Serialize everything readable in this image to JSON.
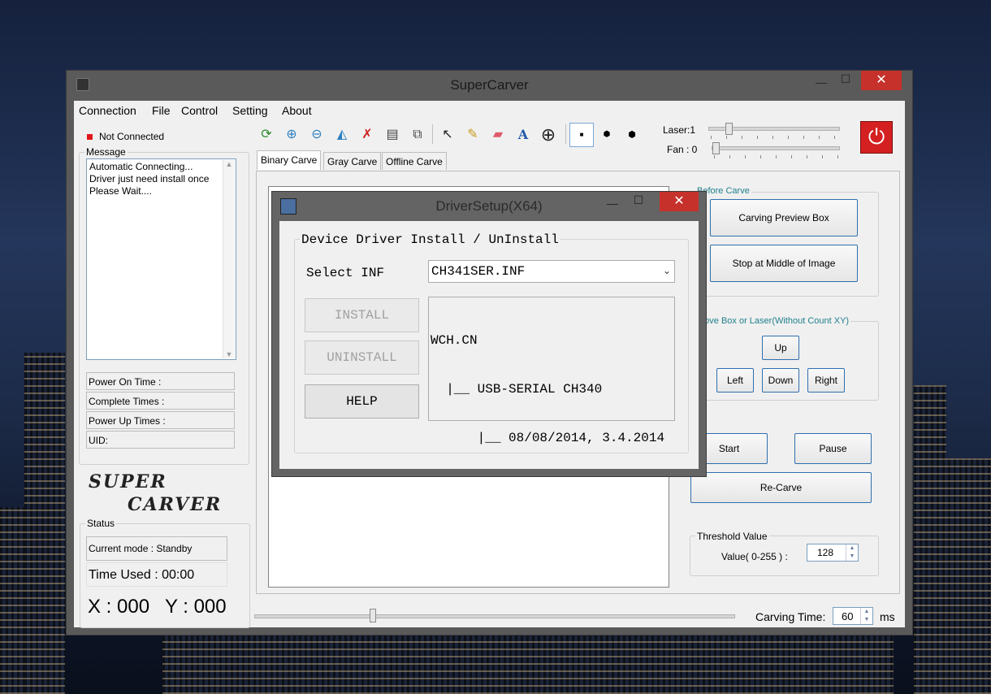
{
  "window": {
    "title": "SuperCarver",
    "minimize": "—",
    "maximize": "☐",
    "close": "✕"
  },
  "menu": [
    "Connection",
    "File",
    "Control",
    "Setting",
    "About"
  ],
  "connection_status": "Not Connected",
  "message": {
    "title": "Message",
    "lines": [
      "Automatic Connecting...",
      "Driver just need install once",
      "Please Wait...."
    ]
  },
  "info": {
    "power_on": "Power On Time :",
    "complete_times": "Complete Times :",
    "power_up_times": "Power Up Times :",
    "uid": "UID:"
  },
  "logo": {
    "line1": "SUPER",
    "line2": "CARVER"
  },
  "status": {
    "title": "Status",
    "mode": "Current mode : Standby",
    "time_used": "Time Used :  00:00",
    "x": "X : 000",
    "y": "Y : 000"
  },
  "laser": {
    "label": "Laser:1",
    "level": 1
  },
  "fan": {
    "label": "Fan : 0",
    "level": 0
  },
  "tabs": [
    "Binary Carve",
    "Gray Carve",
    "Offline Carve"
  ],
  "before_carve": {
    "title": "Before Carve",
    "preview": "Carving Preview Box",
    "stop_middle": "Stop at Middle of Image"
  },
  "move_box": {
    "title": "Move Box or Laser(Without Count XY)",
    "up": "Up",
    "left": "Left",
    "down": "Down",
    "right": "Right"
  },
  "controls": {
    "start": "Start",
    "pause": "Pause",
    "recarve": "Re-Carve"
  },
  "threshold": {
    "title": "Threshold Value",
    "label": "Value( 0-255 ) :",
    "value": "128"
  },
  "carving_time": {
    "label": "Carving Time:",
    "value": "60",
    "unit": "ms"
  },
  "dialog": {
    "title": "DriverSetup(X64)",
    "group_title": "Device Driver Install / UnInstall",
    "select_label": "Select INF",
    "select_value": "CH341SER.INF",
    "install": "INSTALL",
    "uninstall": "UNINSTALL",
    "help": "HELP",
    "info_lines": [
      "WCH.CN",
      "  |__ USB-SERIAL CH340",
      "      |__ 08/08/2014, 3.4.2014"
    ]
  },
  "colors": {
    "close_red": "#c7312b",
    "power_red": "#d42020",
    "teal_title": "#1f7f8c"
  }
}
